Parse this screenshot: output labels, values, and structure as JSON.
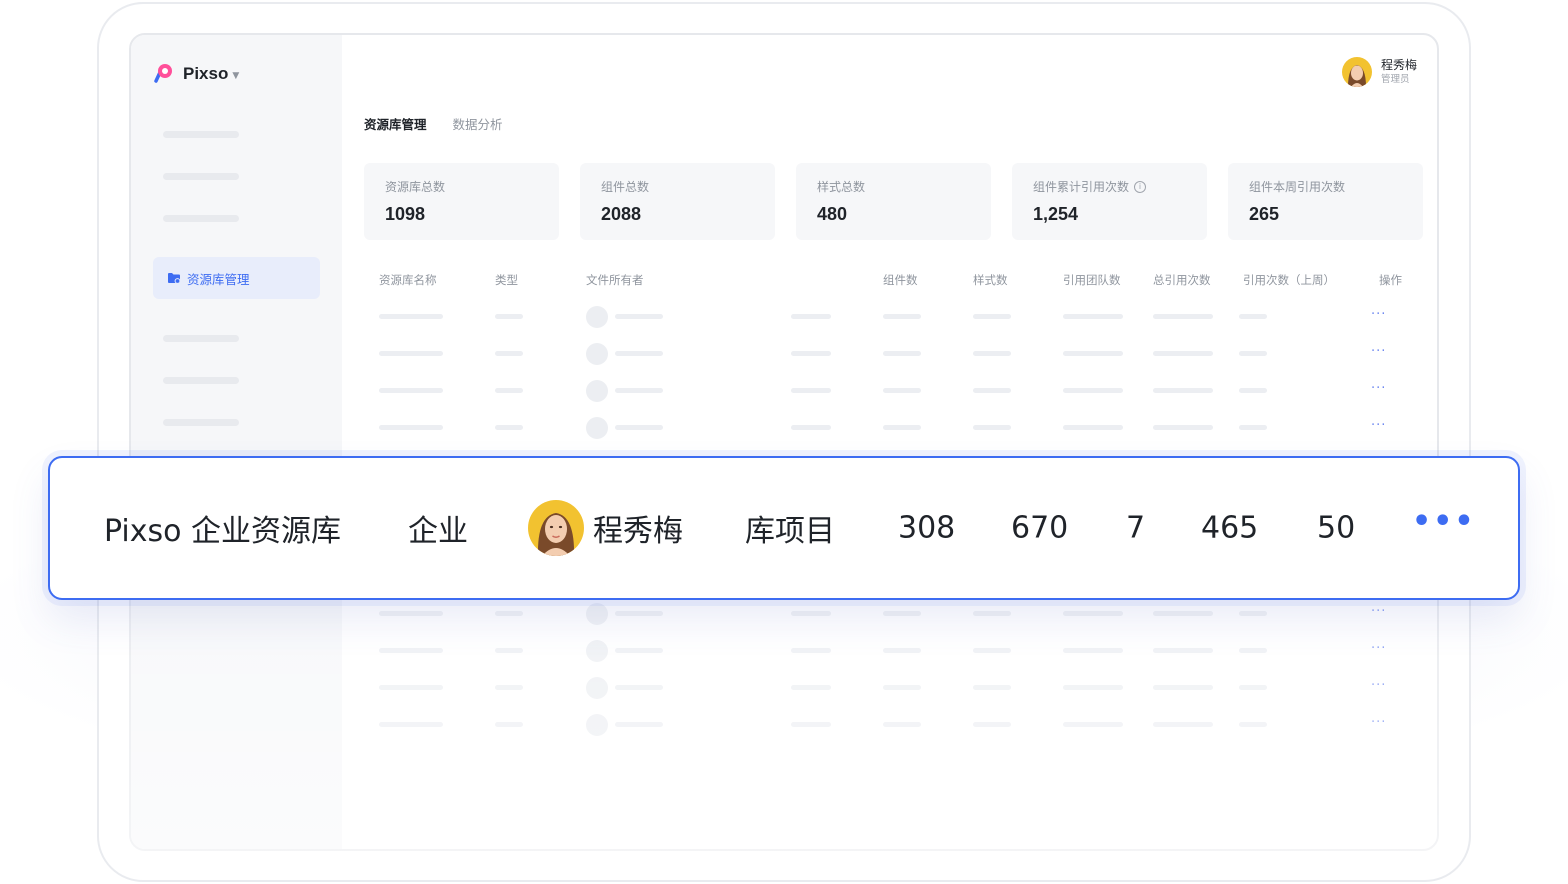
{
  "app": {
    "name": "Pixso"
  },
  "user": {
    "name": "程秀梅",
    "role": "管理员"
  },
  "sidebar": {
    "active_item": "资源库管理"
  },
  "tabs": [
    {
      "label": "资源库管理",
      "active": true
    },
    {
      "label": "数据分析",
      "active": false
    }
  ],
  "stats": [
    {
      "label": "资源库总数",
      "value": "1098"
    },
    {
      "label": "组件总数",
      "value": "2088"
    },
    {
      "label": "样式总数",
      "value": "480"
    },
    {
      "label": "组件累计引用次数",
      "value": "1,254",
      "info": "i"
    },
    {
      "label": "组件本周引用次数",
      "value": "265"
    }
  ],
  "table": {
    "headers": [
      "资源库名称",
      "类型",
      "文件所有者",
      "组件数",
      "样式数",
      "引用团队数",
      "总引用次数",
      "引用次数（上周）",
      "操作"
    ],
    "row_action": "···"
  },
  "highlighted_row": {
    "library_name": "Pixso 企业资源库",
    "type": "企业",
    "owner": "程秀梅",
    "project": "库项目",
    "components": "308",
    "styles": "670",
    "teams": "7",
    "total_refs": "465",
    "last_week_refs": "50",
    "action": "•••"
  },
  "colors": {
    "accent": "#3d6cf2",
    "sidebar_bg": "#f6f7f9",
    "active_bg": "#e8edfb"
  }
}
